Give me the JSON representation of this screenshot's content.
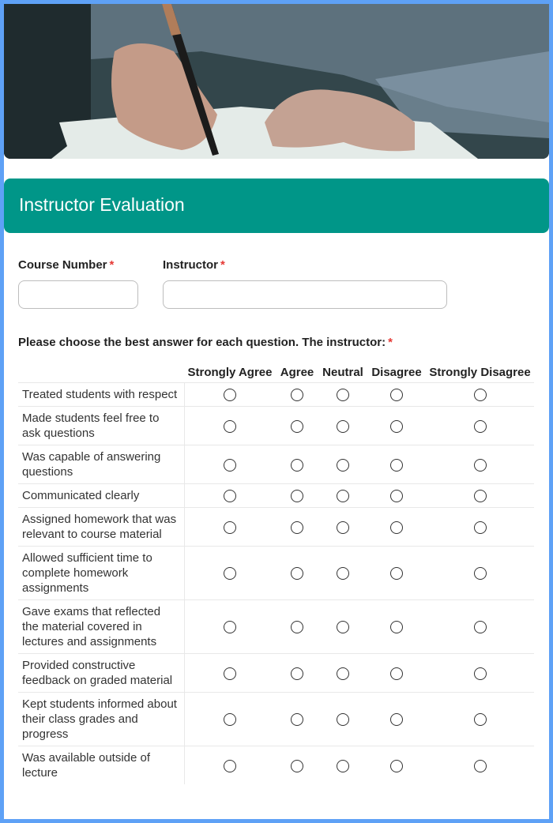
{
  "form": {
    "title": "Instructor Evaluation",
    "header_image": "person-writing-with-pen-photo",
    "fields": [
      {
        "label": "Course Number",
        "required_mark": "*",
        "value": "",
        "placeholder": ""
      },
      {
        "label": "Instructor",
        "required_mark": "*",
        "value": "",
        "placeholder": ""
      }
    ],
    "matrix": {
      "question": "Please choose the best answer for each question. The instructor:",
      "required_mark": "*",
      "columns": [
        "Strongly Agree",
        "Agree",
        "Neutral",
        "Disagree",
        "Strongly Disagree"
      ],
      "rows": [
        "Treated students with respect",
        "Made students feel free to ask questions",
        "Was capable of answering questions",
        "Communicated clearly",
        "Assigned homework that was relevant to course material",
        "Allowed sufficient time to complete homework assignments",
        "Gave exams that reflected the material covered in lectures and assignments",
        "Provided constructive feedback on graded material",
        "Kept students informed about their class grades and progress",
        "Was available outside of lecture"
      ],
      "selected": [
        null,
        null,
        null,
        null,
        null,
        null,
        null,
        null,
        null,
        null
      ]
    }
  },
  "colors": {
    "frame": "#5ea1f6",
    "header_bar": "#009688",
    "required": "#e53935"
  }
}
